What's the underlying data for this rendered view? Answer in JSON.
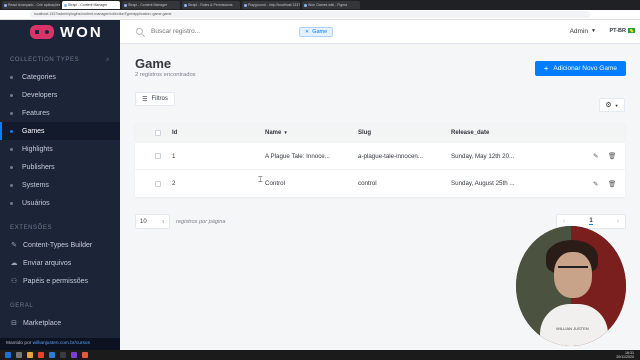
{
  "browser": {
    "tabs": [
      {
        "label": "React Avançado - Crie aplicações"
      },
      {
        "label": "Strapi - Content Manager"
      },
      {
        "label": "Strapi - Content Manager"
      },
      {
        "label": "Strapi - Roles & Permissions"
      },
      {
        "label": "Playground - http://localhost:1337"
      },
      {
        "label": "Won Games wiki - Figma"
      }
    ],
    "address": "localhost:1337/admin/plugins/content-manager/collectionType/application::game.game"
  },
  "sidebar": {
    "brand": "WON",
    "collection_types_label": "COLLECTION TYPES",
    "collection_types": [
      {
        "label": "Categories"
      },
      {
        "label": "Developers"
      },
      {
        "label": "Features"
      },
      {
        "label": "Games"
      },
      {
        "label": "Highlights"
      },
      {
        "label": "Publishers"
      },
      {
        "label": "Systems"
      },
      {
        "label": "Usuários"
      }
    ],
    "extensions_label": "EXTENSÕES",
    "extensions": [
      {
        "label": "Content-Types Builder",
        "icon": "paint-brush-icon"
      },
      {
        "label": "Enviar arquivos",
        "icon": "cloud-upload-icon"
      },
      {
        "label": "Papéis e permissões",
        "icon": "users-icon"
      }
    ],
    "general_label": "GERAL",
    "general": [
      {
        "label": "Marketplace",
        "icon": "shopping-basket-icon"
      }
    ],
    "footer_prefix": "Mantido por ",
    "footer_link": "willianjusten.com.br/cursos"
  },
  "header": {
    "search_placeholder": "Buscar registro...",
    "search_tag": "Game",
    "user": "Admin",
    "lang": "PT-BR"
  },
  "main": {
    "title": "Game",
    "subtitle": "2 registros encontrados",
    "add_button": "Adicionar Novo Game",
    "filters_button": "Filtros"
  },
  "table": {
    "columns": [
      "Id",
      "Name",
      "Slug",
      "Release_date"
    ],
    "rows": [
      {
        "id": "1",
        "name": "A Plague Tale: Innoce...",
        "slug": "a-plague-tale-innocen...",
        "date": "Sunday, May 12th 20..."
      },
      {
        "id": "2",
        "name": "Control",
        "slug": "control",
        "date": "Sunday, August 25th ..."
      }
    ]
  },
  "pagination": {
    "per_page_value": "10",
    "per_page_label": "registros por página",
    "current_page": "1"
  },
  "webcam": {
    "shirt_text": "WILLIAN JUSTEN"
  },
  "taskbar": {
    "time": "18:31",
    "date": "20/11/2020"
  },
  "colors": {
    "accent": "#007eff",
    "sidebar_bg": "#1c2438",
    "brand": "#d9346a"
  }
}
